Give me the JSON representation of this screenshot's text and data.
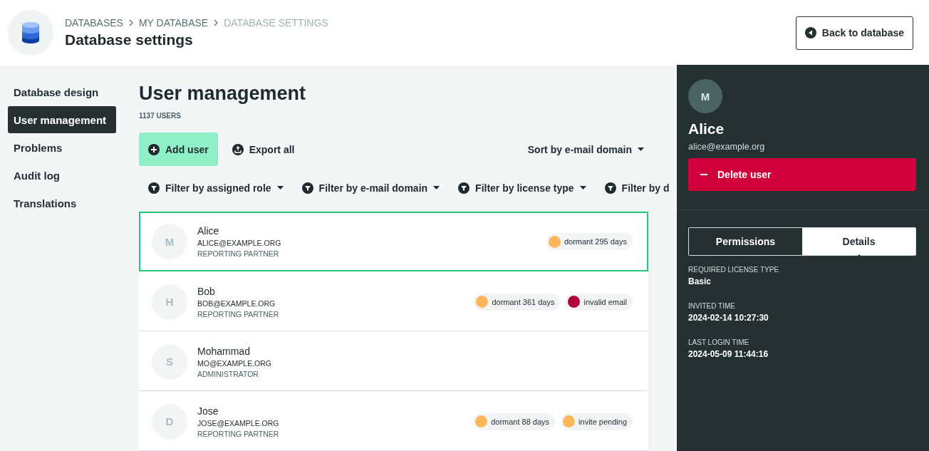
{
  "header": {
    "breadcrumbs": [
      {
        "label": "DATABASES",
        "current": false
      },
      {
        "label": "MY DATABASE",
        "current": false
      },
      {
        "label": "DATABASE SETTINGS",
        "current": true
      }
    ],
    "title": "Database settings",
    "back_button": "Back to database"
  },
  "sidebar": {
    "items": [
      {
        "label": "Database design",
        "selected": false
      },
      {
        "label": "User management",
        "selected": true
      },
      {
        "label": "Problems",
        "selected": false
      },
      {
        "label": "Audit log",
        "selected": false
      },
      {
        "label": "Translations",
        "selected": false
      }
    ]
  },
  "main": {
    "title": "User management",
    "count": "1137 USERS",
    "add_button": "Add user",
    "export_button": "Export all",
    "sort": "Sort by e-mail domain",
    "filters": [
      {
        "label": "Filter by assigned role",
        "cut": false
      },
      {
        "label": "Filter by e-mail domain",
        "cut": false
      },
      {
        "label": "Filter by license type",
        "cut": false
      },
      {
        "label": "Filter by d",
        "cut": true
      }
    ],
    "users": [
      {
        "initial": "M",
        "name": "Alice",
        "email": "ALICE@EXAMPLE.ORG",
        "role": "REPORTING PARTNER",
        "selected": true,
        "tags": [
          {
            "label": "dormant 295 days",
            "color": "#ffb55a"
          }
        ]
      },
      {
        "initial": "H",
        "name": "Bob",
        "email": "BOB@EXAMPLE.ORG",
        "role": "REPORTING PARTNER",
        "selected": false,
        "tags": [
          {
            "label": "dormant 361 days",
            "color": "#ffb55a"
          },
          {
            "label": "invalid email",
            "color": "#b3003c"
          }
        ]
      },
      {
        "initial": "S",
        "name": "Mohammad",
        "email": "MO@EXAMPLE.ORG",
        "role": "ADMINISTRATOR",
        "selected": false
      },
      {
        "initial": "D",
        "name": "Jose",
        "email": "JOSE@EXAMPLE.ORG",
        "role": "REPORTING PARTNER",
        "selected": false,
        "tags": [
          {
            "label": "dormant 88 days",
            "color": "#ffb55a"
          },
          {
            "label": "invite pending",
            "color": "#ffb55a"
          }
        ]
      }
    ]
  },
  "panel": {
    "initial": "M",
    "name": "Alice",
    "email": "alice@example.org",
    "delete_button": "Delete user",
    "tabs": [
      {
        "label": "Permissions",
        "selected": false
      },
      {
        "label": "Details",
        "selected": true
      }
    ],
    "details": [
      {
        "label": "REQUIRED LICENSE TYPE",
        "value": "Basic"
      },
      {
        "label": "INVITED TIME",
        "value": "2024-02-14 10:27:30"
      },
      {
        "label": "LAST LOGIN TIME",
        "value": "2024-05-09 11:44:16"
      }
    ]
  }
}
